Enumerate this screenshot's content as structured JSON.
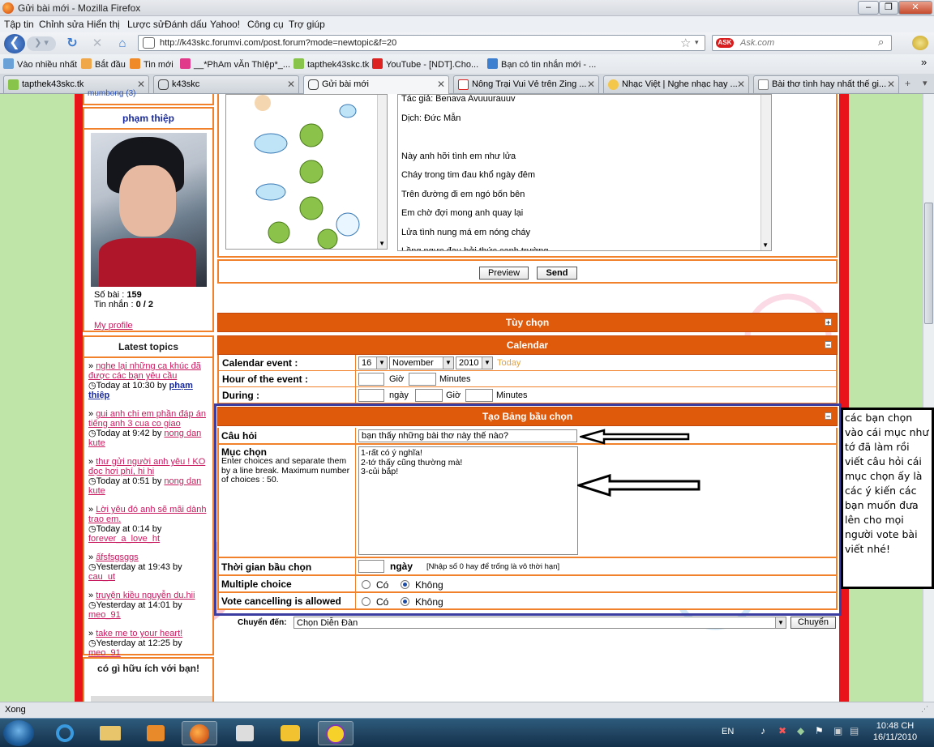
{
  "window": {
    "title": "Gửi bài mới - Mozilla Firefox",
    "controls": [
      "minimize-icon",
      "maximize-icon",
      "close-icon"
    ]
  },
  "menu": [
    "Tập tin",
    "Chỉnh sửa",
    "Hiển thị",
    "Lược sử",
    "Đánh dấu",
    "Yahoo!",
    "Công cụ",
    "Trợ giúp"
  ],
  "nav": {
    "url": "http://k43skc.forumvi.com/post.forum?mode=newtopic&f=20",
    "search_placeholder": "Ask.com"
  },
  "bookmarks": [
    "Vào nhiều nhất",
    "Bắt đầu",
    "Tin mới",
    "__*PhAm vĂn ThIệp*_...",
    "tapthek43skc.tk",
    "YouTube - [NDT].Cho...",
    "Bạn có tin nhắn mới - ..."
  ],
  "tabs": [
    "tapthek43skc.tk",
    "k43skc",
    "Gửi bài mới",
    "Nông Trại Vui Vẻ trên Zing ...",
    "Nhạc Việt | Nghe nhạc hay ...",
    "Bài thơ tình hay nhất thế gi..."
  ],
  "sidebar": {
    "partial_top": "mumbong (3)",
    "profile_title": "phạm thiệp",
    "posts_label": "Số bài :",
    "posts_value": "159",
    "messages_label": "Tin nhắn :",
    "messages_value": "0 / 2",
    "my_profile": "My profile",
    "latest_title": "Latest topics",
    "latest": [
      {
        "title": "nghe lại những ca khúc đã được các bạn yêu cầu",
        "time": "Today at 10:30",
        "by": "by",
        "author": "phạm thiệp"
      },
      {
        "title": "gui anh chi em phần đáp án tiếng anh 3 cua co giao",
        "time": "Today at 9:42",
        "by": "by",
        "author": "nong dan kute"
      },
      {
        "title": "thư gửi người anh yêu ! KO đọc hơi phí, hi hi",
        "time": "Today at 0:51",
        "by": "by",
        "author": "nong dan kute"
      },
      {
        "title": "Lời yêu đó anh sẽ mãi dành trao em.",
        "time": "Today at 0:14",
        "by": "by",
        "author": "forever_a_love_ht"
      },
      {
        "title": "ấfsfsgsggs",
        "time": "Yesterday at 19:43",
        "by": "by",
        "author": "cau_ut"
      },
      {
        "title": "truyện kiều nguyễn du.hii",
        "time": "Yesterday at 14:01",
        "by": "by",
        "author": "meo_91"
      },
      {
        "title": "take me to your heart!",
        "time": "Yesterday at 12:25",
        "by": "by",
        "author": "meo_91"
      }
    ],
    "useful_title": "có gì hữu ích với bạn!"
  },
  "message": {
    "lines": [
      "Tác giả: Benava Avuuurauuv",
      "Dịch:  Đức Mẫn",
      "",
      "Này anh hỡi tình em như lửa",
      "Cháy trong tim đau khổ ngày đêm",
      "Trên đường đi em ngó bốn bên",
      "Em chờ đợi mong anh quay lại",
      "Lửa tình nung má em nóng cháy",
      "Lồng ngực đau bởi thức canh trường"
    ]
  },
  "buttons": {
    "preview": "Preview",
    "send": "Send"
  },
  "options": {
    "title": "Tùy chọn"
  },
  "calendar": {
    "title": "Calendar",
    "event_label": "Calendar event :",
    "day": "16",
    "month": "November",
    "year": "2010",
    "today": "Today",
    "hour_label": "Hour of the event :",
    "hour_unit": "Giờ",
    "minute_unit": "Minutes",
    "during_label": "During :",
    "day_unit": "ngày",
    "during_hour_unit": "Giờ",
    "during_minute_unit": "Minutes"
  },
  "poll": {
    "title": "Tạo Bảng bầu chọn",
    "question_label": "Câu hỏi",
    "question_value": "bạn thấy những bài thơ này thế nào?",
    "choices_label": "Mục chọn",
    "choices_help": "Enter choices and separate them by a line break. Maximum number of choices : 50.",
    "choices": [
      "1-rất có ý nghĩa!",
      "2-tớ thấy cũng thường mà!",
      "3-củi bắp!"
    ],
    "duration_label": "Thời gian bầu chọn",
    "duration_unit": "ngày",
    "duration_note": "[Nhập số 0 hay để trống là vô thời hạn]",
    "multiple_label": "Multiple choice",
    "cancel_label": "Vote cancelling is allowed",
    "yes": "Có",
    "no": "Không"
  },
  "jump": {
    "label": "Chuyển đến:",
    "select": "Chọn Diễn Đàn",
    "button": "Chuyển"
  },
  "annotation_note": "các bạn chọn vào cái mục như tớ đã làm rồi viết câu hỏi cái mục chọn ấy là các ý kiến các bạn muốn đưa lên cho mọi người vote bài viết nhé!",
  "status": "Xong",
  "taskbar": {
    "lang": "EN",
    "time": "10:48 CH",
    "date": "16/11/2010"
  }
}
